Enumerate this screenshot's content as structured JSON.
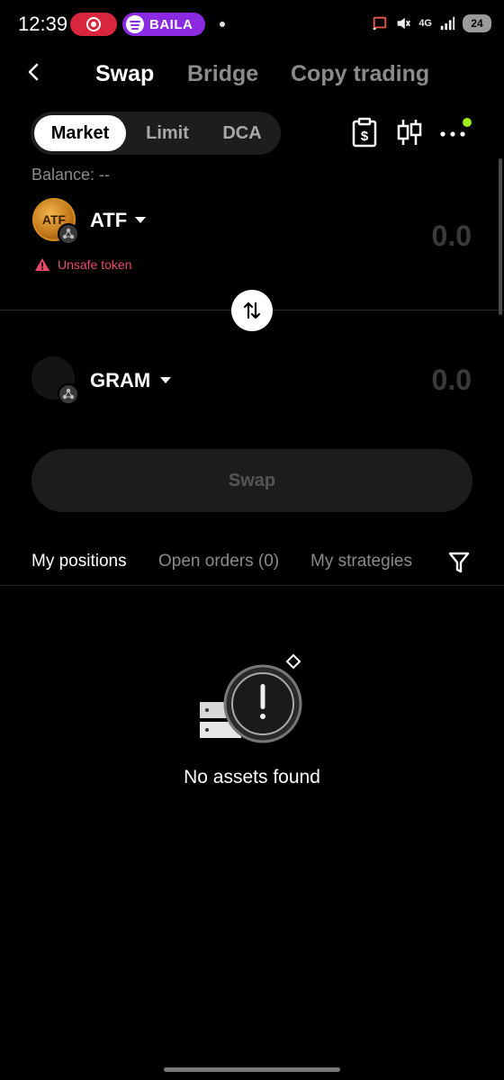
{
  "status_bar": {
    "time": "12:39",
    "media_label": "BAILA",
    "network_label": "4G",
    "battery": "24"
  },
  "nav": {
    "tabs": [
      {
        "label": "Swap",
        "active": true
      },
      {
        "label": "Bridge",
        "active": false
      },
      {
        "label": "Copy trading",
        "active": false
      }
    ]
  },
  "mode": {
    "options": [
      "Market",
      "Limit",
      "DCA"
    ],
    "selected": "Market"
  },
  "balance_label": "Balance: --",
  "from_token": {
    "symbol": "ATF",
    "logo_text": "ATF",
    "amount": "0.0",
    "warning": "Unsafe token"
  },
  "to_token": {
    "symbol": "GRAM",
    "amount": "0.0"
  },
  "swap_button": "Swap",
  "positions_tabs": [
    "My positions",
    "Open orders (0)",
    "My strategies"
  ],
  "empty_state": "No assets found",
  "colors": {
    "accent_green": "#9ef01a",
    "warning_red": "#e84a6a",
    "media_purple": "#8a2be2",
    "record_red": "#d7263d"
  }
}
